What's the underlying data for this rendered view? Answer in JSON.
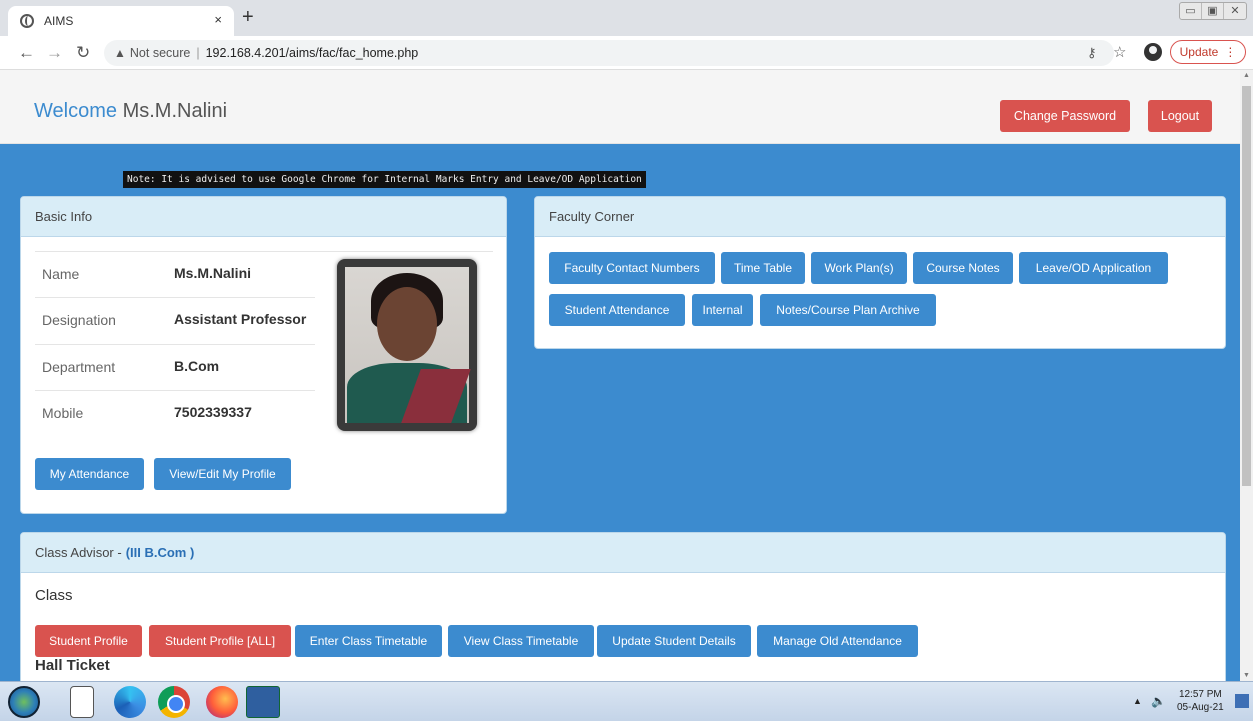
{
  "browser": {
    "tab_title": "AIMS",
    "tab_close": "×",
    "new_tab": "+",
    "security_label": "Not secure",
    "url": "192.168.4.201/aims/fac/fac_home.php",
    "update_label": "Update"
  },
  "header": {
    "welcome": "Welcome",
    "user_name": "Ms.M.Nalini",
    "change_password": "Change Password",
    "logout": "Logout"
  },
  "note": "Note: It is advised to use Google Chrome for Internal Marks Entry and Leave/OD Application",
  "basic_info": {
    "title": "Basic Info",
    "rows": [
      {
        "label": "Name",
        "value": "Ms.M.Nalini"
      },
      {
        "label": "Designation",
        "value": "Assistant Professor"
      },
      {
        "label": "Department",
        "value": "B.Com"
      },
      {
        "label": "Mobile",
        "value": "7502339337"
      }
    ],
    "buttons": [
      "My Attendance",
      "View/Edit My Profile"
    ]
  },
  "faculty_corner": {
    "title": "Faculty Corner",
    "buttons": [
      "Faculty Contact Numbers",
      "Time Table",
      "Work Plan(s)",
      "Course Notes",
      "Leave/OD Application",
      "Student Attendance",
      "Internal",
      "Notes/Course Plan Archive"
    ]
  },
  "class_advisor": {
    "title": "Class Advisor -",
    "class_name": "(III B.Com )",
    "class_label": "Class",
    "buttons": [
      "Student Profile",
      "Student Profile [ALL]",
      "Enter Class Timetable",
      "View Class Timetable",
      "Update Student Details",
      "Manage Old Attendance"
    ],
    "next_section": "Hall Ticket"
  },
  "taskbar": {
    "time": "12:57 PM",
    "date": "05-Aug-21"
  },
  "colors": {
    "page_blue": "#3c8bcf",
    "button_red": "#d9534f",
    "panel_header": "#d9edf7"
  }
}
